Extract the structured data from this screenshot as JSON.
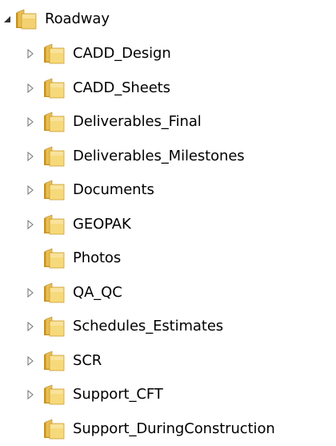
{
  "tree": {
    "root": {
      "label": "Roadway",
      "expanded": true,
      "icon": "folder-icon"
    },
    "children": [
      {
        "label": "CADD_Design",
        "has_children": true
      },
      {
        "label": "CADD_Sheets",
        "has_children": true
      },
      {
        "label": "Deliverables_Final",
        "has_children": true
      },
      {
        "label": "Deliverables_Milestones",
        "has_children": true
      },
      {
        "label": "Documents",
        "has_children": true
      },
      {
        "label": "GEOPAK",
        "has_children": true
      },
      {
        "label": "Photos",
        "has_children": false
      },
      {
        "label": "QA_QC",
        "has_children": true
      },
      {
        "label": "Schedules_Estimates",
        "has_children": true
      },
      {
        "label": "SCR",
        "has_children": true
      },
      {
        "label": "Support_CFT",
        "has_children": true
      },
      {
        "label": "Support_DuringConstruction",
        "has_children": false
      }
    ]
  },
  "colors": {
    "folder_back": "#d9a93a",
    "folder_front": "#f6d97a",
    "folder_edge": "#b8861f",
    "expander_collapsed": "#7a7a7a",
    "expander_expanded": "#333333"
  }
}
